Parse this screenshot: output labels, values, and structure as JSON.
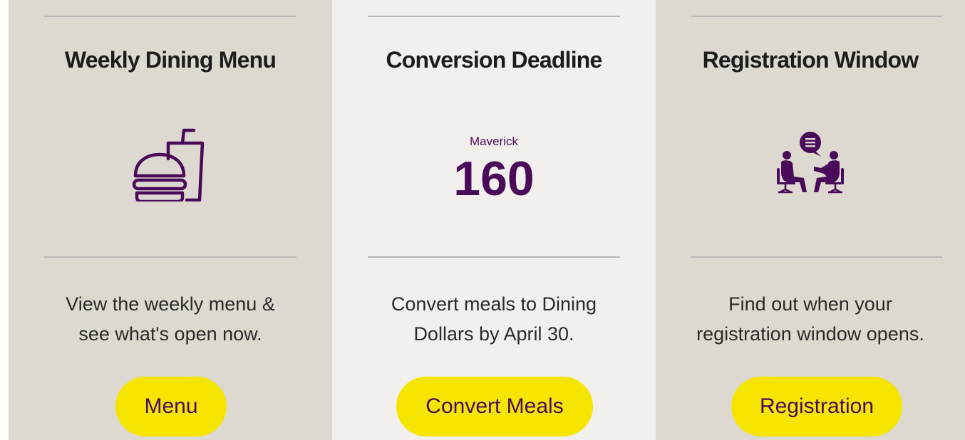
{
  "cards": [
    {
      "title": "Weekly Dining Menu",
      "icon": "burger-drink-icon",
      "desc_line1": "View the weekly menu &",
      "desc_line2": "see what's open now.",
      "button_label": "Menu"
    },
    {
      "title": "Conversion Deadline",
      "icon": "maverick-160-logo",
      "logo_word": "Maverick",
      "logo_number": "160",
      "desc_line1": "Convert meals to Dining",
      "desc_line2": "Dollars by April 30.",
      "button_label": "Convert Meals"
    },
    {
      "title": "Registration Window",
      "icon": "meeting-people-icon",
      "desc_line1": "Find out when your",
      "desc_line2": "registration window opens.",
      "button_label": "Registration"
    }
  ],
  "colors": {
    "accent_purple": "#4a0a5a",
    "button_yellow": "#f6e500",
    "card_beige": "#ded9d0",
    "card_light": "#f2f0ed"
  }
}
